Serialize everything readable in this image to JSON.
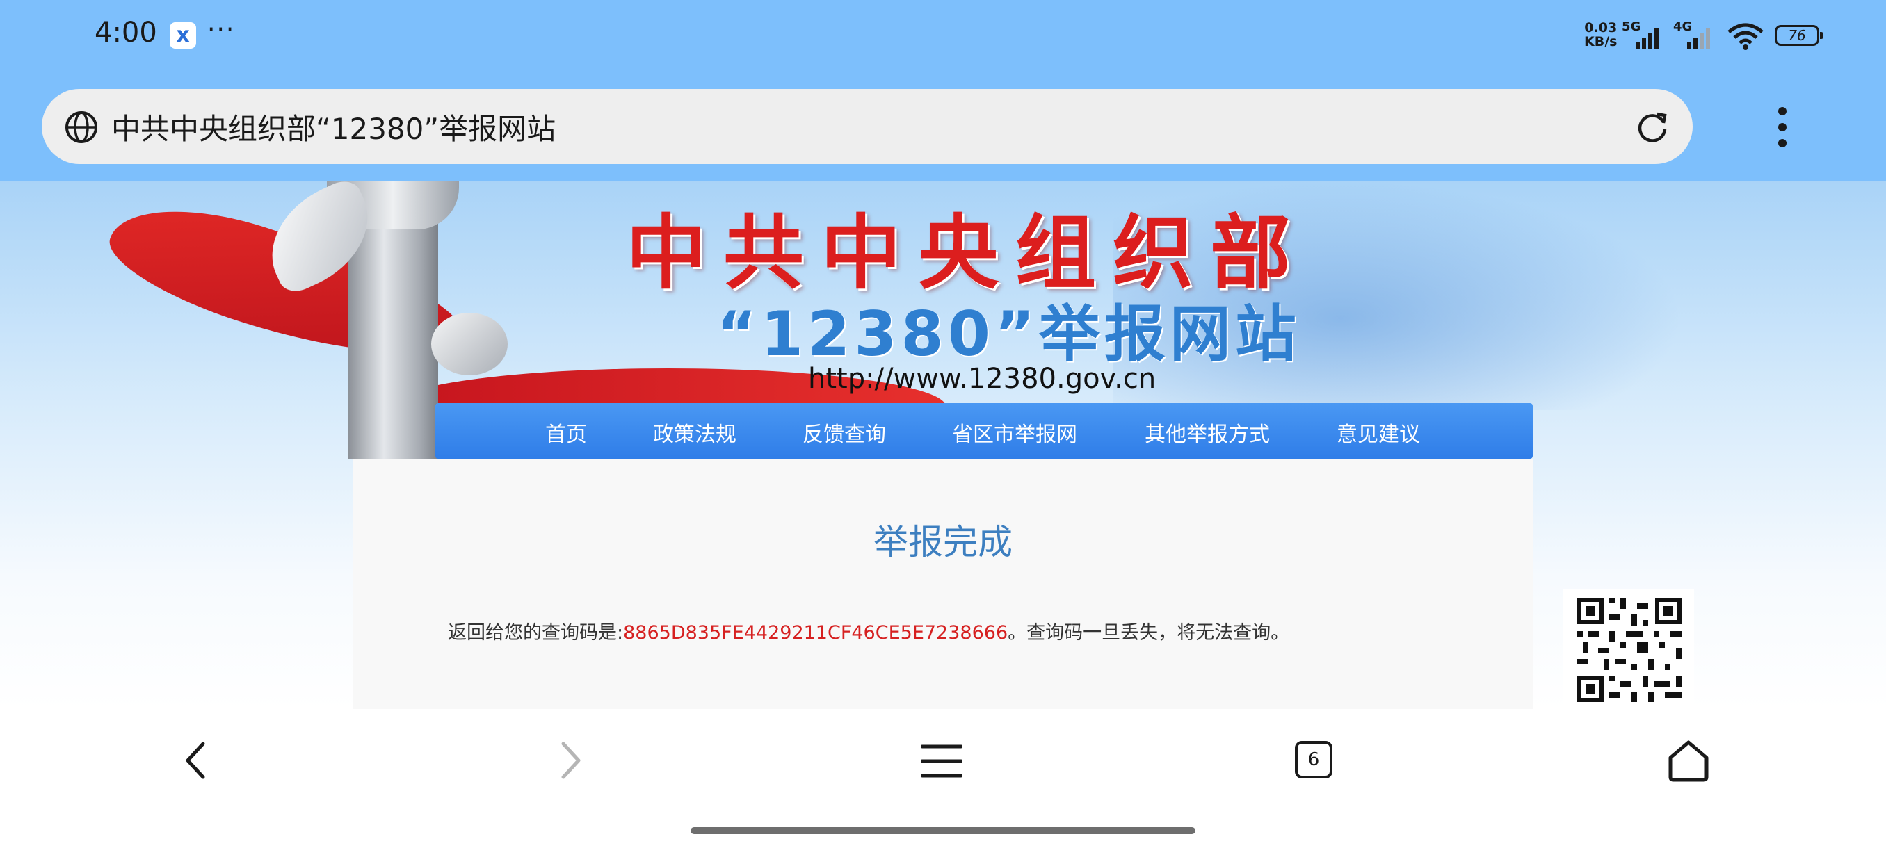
{
  "status_bar": {
    "time": "4:00",
    "app_badge": "x",
    "more": "···",
    "net_speed_value": "0.03",
    "net_speed_unit": "KB/s",
    "signal_1": "5G",
    "signal_2": "4G",
    "battery": "76"
  },
  "address_bar": {
    "title": "中共中央组织部“12380”举报网站"
  },
  "site": {
    "title_line1": "中共中央组织部",
    "title_line2": "“12380”举报网站",
    "url": "http://www.12380.gov.cn",
    "nav": [
      "首页",
      "政策法规",
      "反馈查询",
      "省区市举报网",
      "其他举报方式",
      "意见建议"
    ],
    "panel_title": "举报完成",
    "result_prefix": "返回给您的查询码是:",
    "query_code": "8865D835FE4429211CF46CE5E7238666",
    "result_suffix": "。查询码一旦丢失，将无法查询。"
  },
  "bottom_bar": {
    "tab_count": "6"
  },
  "icons": {
    "back": "chevron-left-icon",
    "forward": "chevron-right-icon",
    "menu": "hamburger-icon",
    "tabs": "tabs-icon",
    "home": "home-icon"
  }
}
